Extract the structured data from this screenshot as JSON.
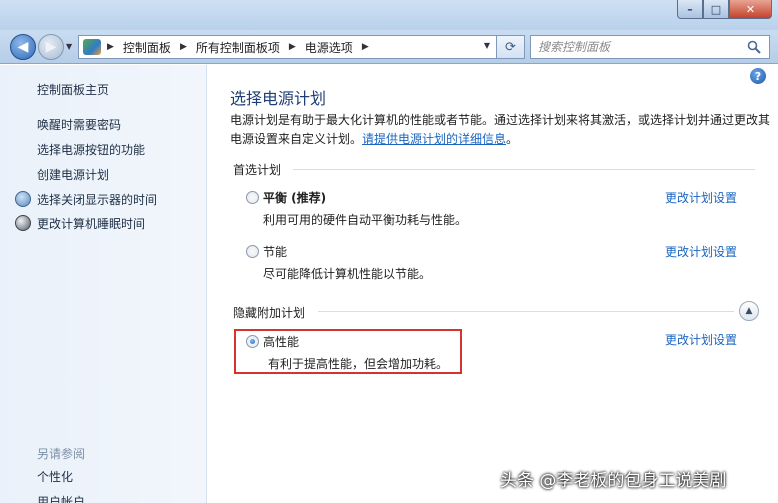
{
  "window": {
    "min": "–",
    "max": "□",
    "close": "✕"
  },
  "breadcrumb": [
    "控制面板",
    "所有控制面板项",
    "电源选项"
  ],
  "search": {
    "placeholder": "搜索控制面板"
  },
  "sidebar": {
    "home": "控制面板主页",
    "links": [
      "唤醒时需要密码",
      "选择电源按钮的功能",
      "创建电源计划",
      "选择关闭显示器的时间",
      "更改计算机睡眠时间"
    ],
    "see_also": "另请参阅",
    "see_also_links": [
      "个性化",
      "用户帐户"
    ]
  },
  "main": {
    "title": "选择电源计划",
    "description": "电源计划是有助于最大化计算机的性能或者节能。通过选择计划来将其激活，或选择计划并通过更改其电源设置来自定义计划。",
    "description_link": "请提供电源计划的详细信息",
    "description_end": "。",
    "preferred_header": "首选计划",
    "hidden_header": "隐藏附加计划",
    "change_label": "更改计划设置",
    "plans": [
      {
        "name": "平衡 (推荐)",
        "desc": "利用可用的硬件自动平衡功耗与性能。",
        "selected": false
      },
      {
        "name": "节能",
        "desc": "尽可能降低计算机性能以节能。",
        "selected": false
      },
      {
        "name": "高性能",
        "desc": "有利于提高性能，但会增加功耗。",
        "selected": true
      }
    ]
  },
  "watermark": "头条 @李老板的包身工说美剧"
}
